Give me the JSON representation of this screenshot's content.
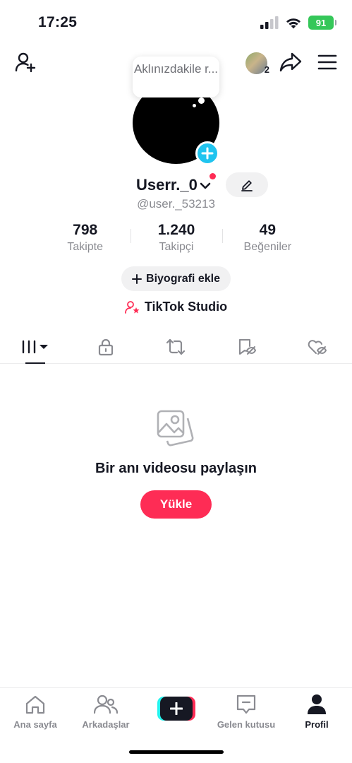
{
  "status_bar": {
    "time": "17:25",
    "battery": "91"
  },
  "topbar": {
    "friend_count": "2"
  },
  "note": {
    "text": "Aklınızdakile r..."
  },
  "profile": {
    "display_name": "Userr._0",
    "username": "@user._53213",
    "stats": [
      {
        "value": "798",
        "label": "Takipte"
      },
      {
        "value": "1.240",
        "label": "Takipçi"
      },
      {
        "value": "49",
        "label": "Beğeniler"
      }
    ],
    "bio_button": "Biyografi ekle",
    "studio_link": "TikTok Studio"
  },
  "empty_state": {
    "title": "Bir anı videosu paylaşın",
    "upload_label": "Yükle"
  },
  "bottom_nav": {
    "home": "Ana sayfa",
    "friends": "Arkadaşlar",
    "inbox": "Gelen kutusu",
    "profile": "Profil"
  },
  "colors": {
    "accent": "#fe2c55",
    "cyan": "#20c4ef",
    "battery": "#35c759"
  }
}
